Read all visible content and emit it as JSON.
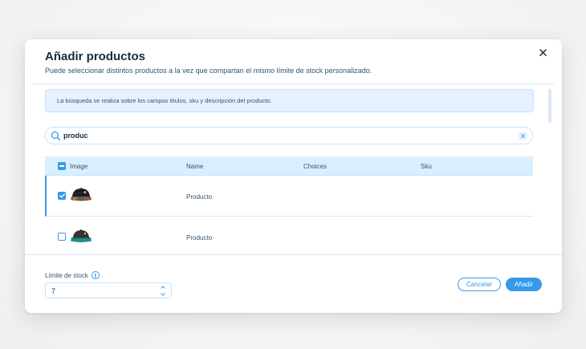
{
  "dialog": {
    "title": "Añadir productos",
    "subtitle": "Puede seleccionar distintos productos a la vez que compartan el mismo límite de stock personalizado."
  },
  "info_box": {
    "text": "La búsqueda se realiza sobre los campos títulos, sku y descripción del producto."
  },
  "search": {
    "value": "produc",
    "placeholder": ""
  },
  "table": {
    "columns": [
      "Image",
      "Name",
      "Choices",
      "Sku"
    ],
    "rows": [
      {
        "selected": true,
        "name": "Producto",
        "choices": "",
        "sku": ""
      },
      {
        "selected": false,
        "name": "Producto",
        "choices": "",
        "sku": ""
      }
    ]
  },
  "footer": {
    "stock_label": "Límite de stock",
    "stock_value": "7",
    "cancel_label": "Cancelar",
    "add_label": "Añadir"
  },
  "icons": {
    "close": "close-icon",
    "search": "search-icon",
    "clear": "clear-icon",
    "info": "info-icon",
    "stepper": "stepper-icon",
    "checkbox": "checkbox-icon"
  },
  "colors": {
    "accent": "#3899ec",
    "title": "#162d3d",
    "text_secondary": "#32536a",
    "info_bg": "#e7f0ff",
    "table_header_bg": "#daeffe",
    "border": "#c1e4fe"
  }
}
